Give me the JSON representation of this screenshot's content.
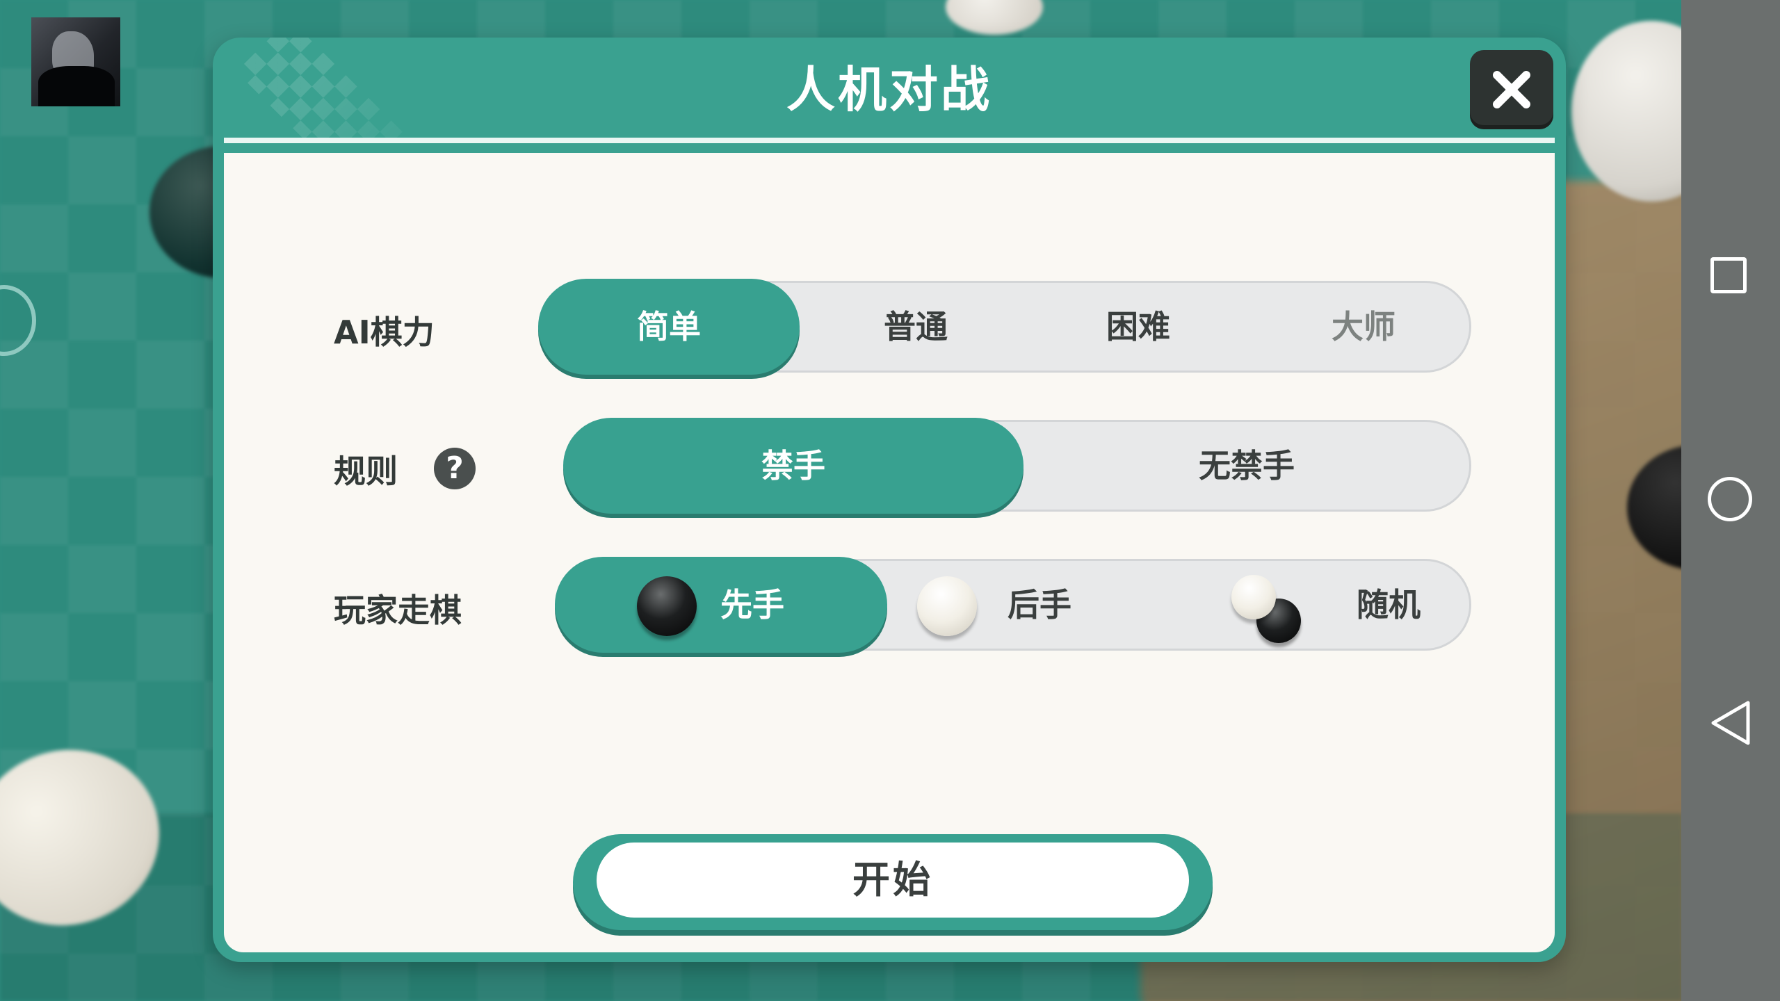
{
  "dialog": {
    "title": "人机对战",
    "close_icon": "close-icon"
  },
  "ai_level": {
    "label": "AI棋力",
    "options": [
      "简单",
      "普通",
      "困难",
      "大师"
    ],
    "selected": "简单"
  },
  "rules": {
    "label": "规则",
    "help_icon": "help-icon",
    "help_symbol": "?",
    "options": [
      "禁手",
      "无禁手"
    ],
    "selected": "禁手"
  },
  "player_move": {
    "label": "玩家走棋",
    "options": [
      "先手",
      "后手",
      "随机"
    ],
    "selected": "先手"
  },
  "start_button": {
    "label": "开始"
  },
  "colors": {
    "accent": "#38a190",
    "dialog_frame": "#3aa190",
    "body_bg": "#faf8f3",
    "close_bg": "#2d3331"
  },
  "navbar": {
    "icons": [
      "recents-square-icon",
      "home-circle-icon",
      "back-triangle-icon"
    ]
  }
}
